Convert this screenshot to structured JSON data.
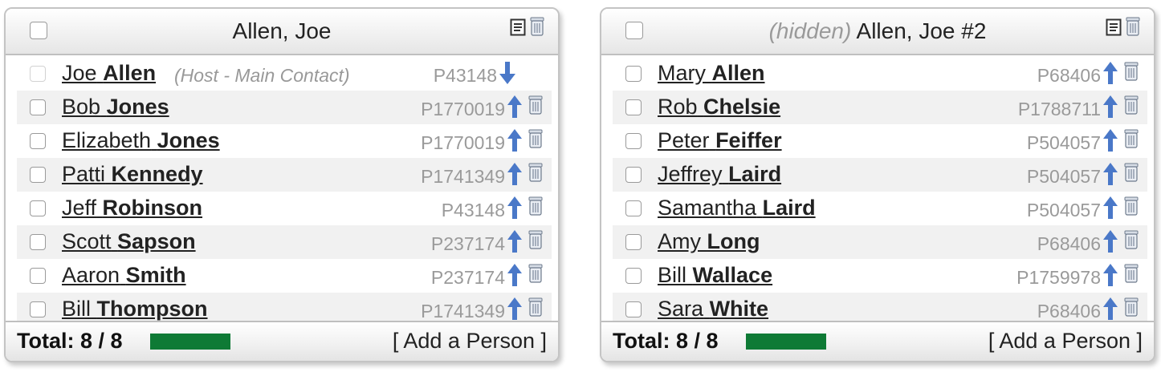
{
  "panels": [
    {
      "title": "Allen, Joe",
      "hidden_label": "",
      "rows": [
        {
          "first": "Joe",
          "last": "Allen",
          "note": "(Host - Main Contact)",
          "pid": "P43148",
          "arrow": "down",
          "trash": false
        },
        {
          "first": "Bob",
          "last": "Jones",
          "note": "",
          "pid": "P1770019",
          "arrow": "up",
          "trash": true
        },
        {
          "first": "Elizabeth",
          "last": "Jones",
          "note": "",
          "pid": "P1770019",
          "arrow": "up",
          "trash": true
        },
        {
          "first": "Patti",
          "last": "Kennedy",
          "note": "",
          "pid": "P1741349",
          "arrow": "up",
          "trash": true
        },
        {
          "first": "Jeff",
          "last": "Robinson",
          "note": "",
          "pid": "P43148",
          "arrow": "up",
          "trash": true
        },
        {
          "first": "Scott",
          "last": "Sapson",
          "note": "",
          "pid": "P237174",
          "arrow": "up",
          "trash": true
        },
        {
          "first": "Aaron",
          "last": "Smith",
          "note": "",
          "pid": "P237174",
          "arrow": "up",
          "trash": true
        },
        {
          "first": "Bill",
          "last": "Thompson",
          "note": "",
          "pid": "P1741349",
          "arrow": "up",
          "trash": true
        }
      ],
      "footer": {
        "total_label": "Total: 8 / 8",
        "progress": 1.0,
        "add_label": "[ Add a Person ]"
      }
    },
    {
      "title": "Allen, Joe #2",
      "hidden_label": "(hidden)",
      "rows": [
        {
          "first": "Mary",
          "last": "Allen",
          "note": "",
          "pid": "P68406",
          "arrow": "up",
          "trash": true
        },
        {
          "first": "Rob",
          "last": "Chelsie",
          "note": "",
          "pid": "P1788711",
          "arrow": "up",
          "trash": true
        },
        {
          "first": "Peter",
          "last": "Feiffer",
          "note": "",
          "pid": "P504057",
          "arrow": "up",
          "trash": true
        },
        {
          "first": "Jeffrey",
          "last": "Laird",
          "note": "",
          "pid": "P504057",
          "arrow": "up",
          "trash": true
        },
        {
          "first": "Samantha",
          "last": "Laird",
          "note": "",
          "pid": "P504057",
          "arrow": "up",
          "trash": true
        },
        {
          "first": "Amy",
          "last": "Long",
          "note": "",
          "pid": "P68406",
          "arrow": "up",
          "trash": true
        },
        {
          "first": "Bill",
          "last": "Wallace",
          "note": "",
          "pid": "P1759978",
          "arrow": "up",
          "trash": true
        },
        {
          "first": "Sara",
          "last": "White",
          "note": "",
          "pid": "P68406",
          "arrow": "up",
          "trash": true
        }
      ],
      "footer": {
        "total_label": "Total: 8 / 8",
        "progress": 1.0,
        "add_label": "[ Add a Person ]"
      }
    }
  ],
  "colors": {
    "progress": "#0e7a35",
    "arrow": "#4a78c8"
  },
  "icons": {
    "header": [
      "document-icon",
      "trash-icon"
    ],
    "row_move": "arrow-icon",
    "row_delete": "trash-icon"
  }
}
